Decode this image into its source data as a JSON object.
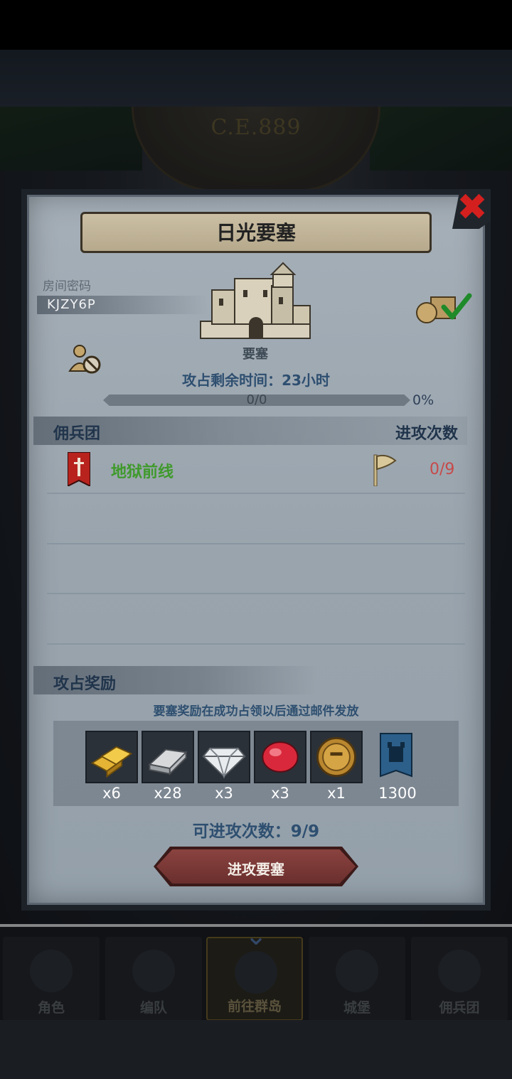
{
  "background": {
    "era": "C.E.889"
  },
  "bottom_nav": {
    "items": [
      {
        "label": "角色"
      },
      {
        "label": "编队"
      },
      {
        "label": "前往群岛"
      },
      {
        "label": "城堡"
      },
      {
        "label": "佣兵团"
      }
    ]
  },
  "dialog": {
    "title": "日光要塞",
    "room_password_label": "房间密码",
    "room_password": "KJZY6P",
    "fortress_label": "要塞",
    "time_remaining": "攻占剩余时间：23小时",
    "progress": {
      "text": "0/0",
      "percent_text": "0%",
      "fraction": 0
    },
    "roster_header": {
      "left": "佣兵团",
      "right": "进攻次数"
    },
    "guilds": [
      {
        "name": "地狱前线",
        "attacks": "0/9"
      }
    ],
    "rewards_header": "攻占奖励",
    "rewards_note": "要塞奖励在成功占领以后通过邮件发放",
    "rewards": [
      {
        "icon": "gold-bars-icon",
        "qty": "x6"
      },
      {
        "icon": "silver-bar-icon",
        "qty": "x28"
      },
      {
        "icon": "diamond-icon",
        "qty": "x3"
      },
      {
        "icon": "ruby-icon",
        "qty": "x3"
      },
      {
        "icon": "helmet-coin-icon",
        "qty": "x1"
      },
      {
        "icon": "castle-banner-icon",
        "qty": "1300"
      }
    ],
    "attacks_available": "可进攻次数：9/9",
    "attack_button": "进攻要塞"
  },
  "colors": {
    "accent_text": "#2e4f70",
    "guild_name": "#3f9a2c",
    "attack_count": "#c74a4a",
    "close": "#d3201e"
  }
}
